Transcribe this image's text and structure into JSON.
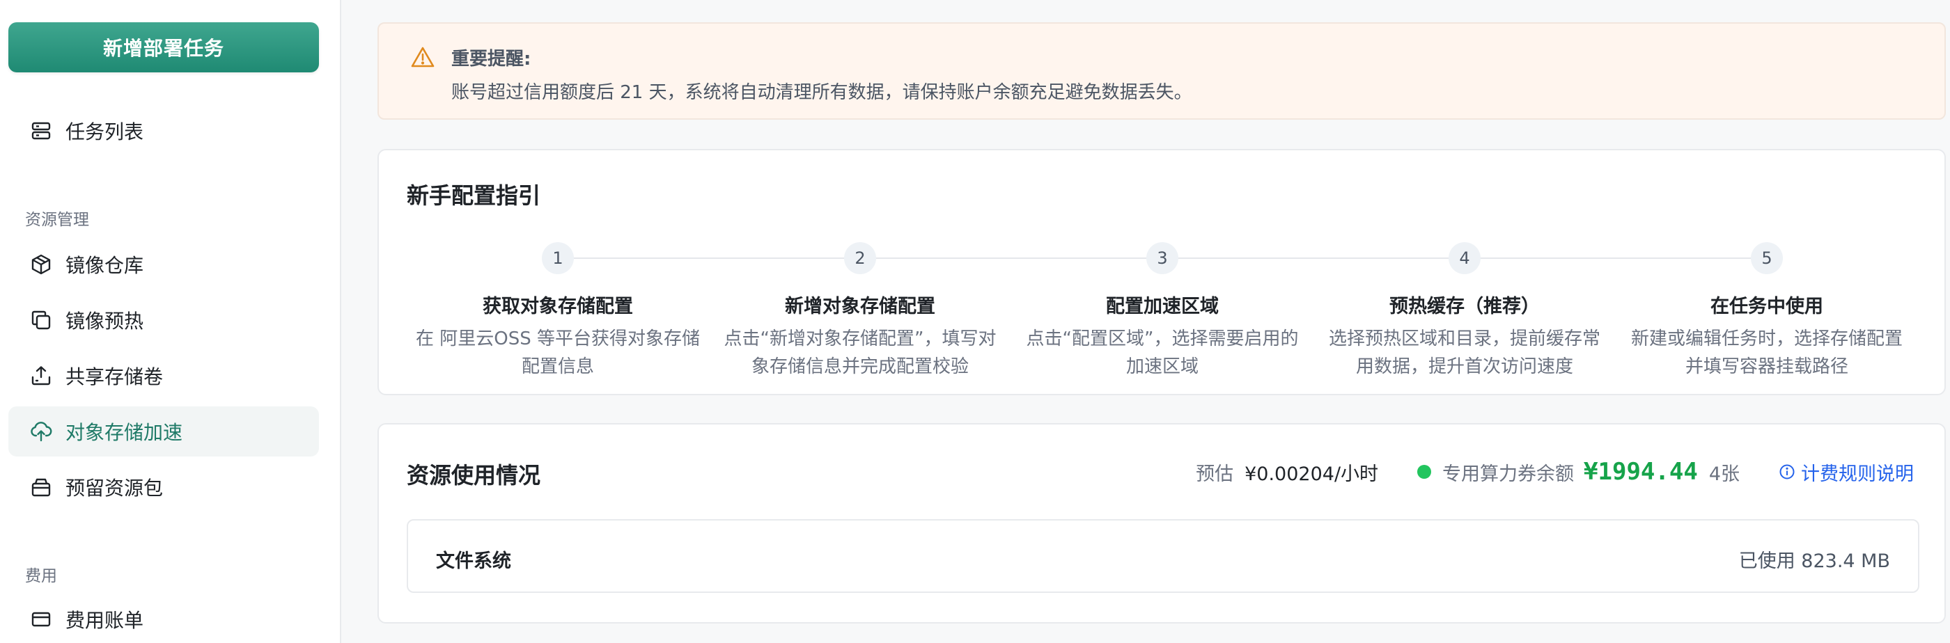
{
  "sidebar": {
    "new_task_label": "新增部署任务",
    "task_list_label": "任务列表",
    "group_resource": "资源管理",
    "items_resource": [
      {
        "label": "镜像仓库",
        "icon": "cube-icon"
      },
      {
        "label": "镜像预热",
        "icon": "copy-icon"
      },
      {
        "label": "共享存储卷",
        "icon": "upload-tray-icon"
      },
      {
        "label": "对象存储加速",
        "icon": "cloud-upload-icon",
        "active": true
      },
      {
        "label": "预留资源包",
        "icon": "package-icon"
      }
    ],
    "group_billing": "费用",
    "billing_item": {
      "label": "费用账单",
      "icon": "credit-card-icon"
    }
  },
  "alert": {
    "title": "重要提醒:",
    "text": "账号超过信用额度后 21 天，系统将自动清理所有数据，请保持账户余额充足避免数据丢失。"
  },
  "guide": {
    "title": "新手配置指引",
    "steps": [
      {
        "num": "1",
        "title": "获取对象存储配置",
        "desc": "在 阿里云OSS 等平台获得对象存储配置信息"
      },
      {
        "num": "2",
        "title": "新增对象存储配置",
        "desc": "点击“新增对象存储配置”，填写对象存储信息并完成配置校验"
      },
      {
        "num": "3",
        "title": "配置加速区域",
        "desc": "点击“配置区域”，选择需要启用的加速区域"
      },
      {
        "num": "4",
        "title": "预热缓存（推荐）",
        "desc": "选择预热区域和目录，提前缓存常用数据，提升首次访问速度"
      },
      {
        "num": "5",
        "title": "在任务中使用",
        "desc": "新建或编辑任务时，选择存储配置并填写容器挂载路径"
      }
    ]
  },
  "usage": {
    "title": "资源使用情况",
    "estimate_label": "预估",
    "estimate_value": "¥0.00204/小时",
    "balance_label": "专用算力券余额",
    "balance_value": "¥1994.44",
    "balance_count": "4张",
    "billing_link": "计费规则说明",
    "fs_label": "文件系统",
    "fs_usage": "已使用 823.4 MB"
  },
  "colors": {
    "accent": "#1f8a73",
    "active_text": "#1f7a67",
    "balance_green": "#16a34a",
    "link_blue": "#2563eb",
    "alert_bg": "#fff5ee",
    "warning": "#e08a1e"
  }
}
